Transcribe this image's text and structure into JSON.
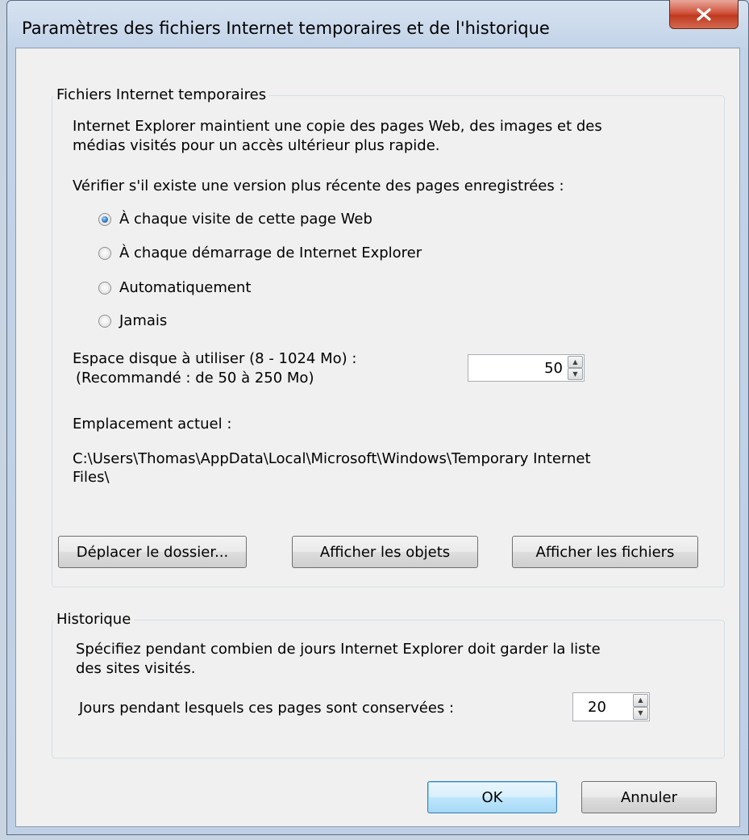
{
  "window": {
    "title": "Paramètres des fichiers Internet temporaires et de l'historique"
  },
  "temp_files": {
    "group_label": "Fichiers Internet temporaires",
    "description_line1": "Internet Explorer maintient une copie des pages Web, des images et des",
    "description_line2": "médias visités pour un accès ultérieur plus rapide.",
    "check_label": "Vérifier s'il existe une version plus récente des pages enregistrées :",
    "options": [
      {
        "label": "À chaque visite de cette page Web",
        "checked": true
      },
      {
        "label": "À chaque démarrage de Internet Explorer",
        "checked": false
      },
      {
        "label": "Automatiquement",
        "checked": false
      },
      {
        "label": "Jamais",
        "checked": false
      }
    ],
    "disk_space_label": "Espace disque à utiliser (8 - 1024 Mo) :",
    "disk_space_hint": "(Recommandé : de 50 à 250 Mo)",
    "disk_space_value": "50",
    "location_label": "Emplacement actuel :",
    "location_path_line1": "C:\\Users\\Thomas\\AppData\\Local\\Microsoft\\Windows\\Temporary Internet",
    "location_path_line2": "Files\\",
    "buttons": {
      "move_folder": "Déplacer le dossier...",
      "view_objects": "Afficher les objets",
      "view_files": "Afficher les fichiers"
    }
  },
  "history": {
    "group_label": "Historique",
    "description_line1": "Spécifiez pendant combien de jours Internet Explorer doit garder la liste",
    "description_line2": "des sites visités.",
    "days_label": "Jours pendant lesquels ces pages sont conservées :",
    "days_value": "20"
  },
  "footer": {
    "ok_label": "OK",
    "cancel_label": "Annuler"
  },
  "colors": {
    "close_button": "#c8442a",
    "default_button_border": "#3c7fb1",
    "dialog_background": "#f0f0f0"
  }
}
